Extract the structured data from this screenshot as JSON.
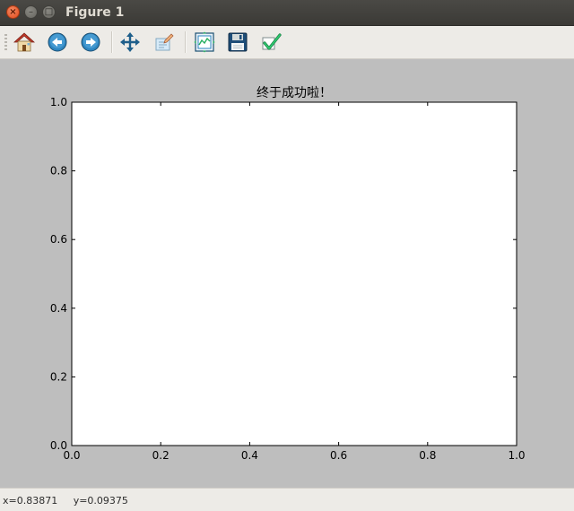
{
  "window": {
    "title": "Figure 1",
    "close_glyph": "×",
    "minimize_glyph": "–",
    "maximize_glyph": "□"
  },
  "toolbar": {
    "items": [
      {
        "name": "home",
        "icon": "home-icon"
      },
      {
        "name": "back",
        "icon": "back-arrow-icon"
      },
      {
        "name": "forward",
        "icon": "forward-arrow-icon"
      },
      {
        "name": "pan",
        "icon": "move-icon"
      },
      {
        "name": "zoom",
        "icon": "zoom-rect-icon"
      },
      {
        "name": "subplots",
        "icon": "subplots-icon"
      },
      {
        "name": "save",
        "icon": "floppy-icon"
      },
      {
        "name": "edit",
        "icon": "checkmark-icon"
      }
    ]
  },
  "chart_data": {
    "type": "line",
    "title": "终于成功啦！",
    "xlabel": "",
    "ylabel": "",
    "xlim": [
      0.0,
      1.0
    ],
    "ylim": [
      0.0,
      1.0
    ],
    "xticks": [
      "0.0",
      "0.2",
      "0.4",
      "0.6",
      "0.8",
      "1.0"
    ],
    "yticks": [
      "0.0",
      "0.2",
      "0.4",
      "0.6",
      "0.8",
      "1.0"
    ],
    "series": [],
    "grid": false
  },
  "status": {
    "text": "x=0.83871     y=0.09375"
  },
  "colors": {
    "figure_bg": "#bebebe",
    "axes_bg": "#ffffff",
    "toolbar_bg": "#edebe7",
    "titlebar_bg": "#3b3a36"
  }
}
